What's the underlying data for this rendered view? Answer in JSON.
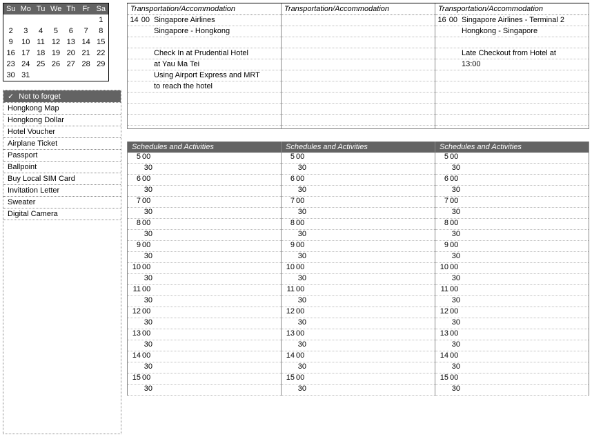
{
  "calendar": {
    "days": [
      "Su",
      "Mo",
      "Tu",
      "We",
      "Th",
      "Fr",
      "Sa"
    ],
    "weeks": [
      [
        "",
        "",
        "",
        "",
        "",
        "",
        "1"
      ],
      [
        "2",
        "3",
        "4",
        "5",
        "6",
        "7",
        "8"
      ],
      [
        "9",
        "10",
        "11",
        "12",
        "13",
        "14",
        "15"
      ],
      [
        "16",
        "17",
        "18",
        "19",
        "20",
        "21",
        "22"
      ],
      [
        "23",
        "24",
        "25",
        "26",
        "27",
        "28",
        "29"
      ],
      [
        "30",
        "31",
        "",
        "",
        "",
        "",
        ""
      ]
    ]
  },
  "not_to_forget": {
    "title": "Not to forget",
    "check": "✓",
    "items": [
      "Hongkong Map",
      "Hongkong Dollar",
      "Hotel Voucher",
      "Airplane Ticket",
      "Passport",
      "Ballpoint",
      "Buy Local SIM Card",
      "Invitation Letter",
      "Sweater",
      "Digital Camera"
    ]
  },
  "transport_header": "Transportation/Accommodation",
  "transport_cols": [
    {
      "lines": [
        {
          "hr": "14",
          "mn": "00",
          "text": "Singapore Airlines"
        },
        {
          "hr": "",
          "mn": "",
          "text": "Singapore - Hongkong"
        },
        {
          "hr": "",
          "mn": "",
          "text": ""
        },
        {
          "hr": "",
          "mn": "",
          "text": "Check In at Prudential Hotel"
        },
        {
          "hr": "",
          "mn": "",
          "text": "at Yau Ma Tei"
        },
        {
          "hr": "",
          "mn": "",
          "text": "Using Airport Express and MRT"
        },
        {
          "hr": "",
          "mn": "",
          "text": "to reach the hotel"
        },
        {
          "hr": "",
          "mn": "",
          "text": ""
        },
        {
          "hr": "",
          "mn": "",
          "text": ""
        },
        {
          "hr": "",
          "mn": "",
          "text": ""
        }
      ]
    },
    {
      "lines": [
        {
          "hr": "",
          "mn": "",
          "text": ""
        },
        {
          "hr": "",
          "mn": "",
          "text": ""
        },
        {
          "hr": "",
          "mn": "",
          "text": ""
        },
        {
          "hr": "",
          "mn": "",
          "text": ""
        },
        {
          "hr": "",
          "mn": "",
          "text": ""
        },
        {
          "hr": "",
          "mn": "",
          "text": ""
        },
        {
          "hr": "",
          "mn": "",
          "text": ""
        },
        {
          "hr": "",
          "mn": "",
          "text": ""
        },
        {
          "hr": "",
          "mn": "",
          "text": ""
        },
        {
          "hr": "",
          "mn": "",
          "text": ""
        }
      ]
    },
    {
      "lines": [
        {
          "hr": "16",
          "mn": "00",
          "text": "Singapore Airlines - Terminal 2"
        },
        {
          "hr": "",
          "mn": "",
          "text": "Hongkong - Singapore"
        },
        {
          "hr": "",
          "mn": "",
          "text": ""
        },
        {
          "hr": "",
          "mn": "",
          "text": "Late Checkout from Hotel at"
        },
        {
          "hr": "",
          "mn": "",
          "text": "13:00"
        },
        {
          "hr": "",
          "mn": "",
          "text": ""
        },
        {
          "hr": "",
          "mn": "",
          "text": ""
        },
        {
          "hr": "",
          "mn": "",
          "text": ""
        },
        {
          "hr": "",
          "mn": "",
          "text": ""
        },
        {
          "hr": "",
          "mn": "",
          "text": ""
        }
      ]
    }
  ],
  "schedule_header": "Schedules and Activities",
  "schedule_hours": [
    "5",
    "6",
    "7",
    "8",
    "9",
    "10",
    "11",
    "12",
    "13",
    "14",
    "15"
  ],
  "schedule_minutes": [
    "00",
    "30"
  ]
}
